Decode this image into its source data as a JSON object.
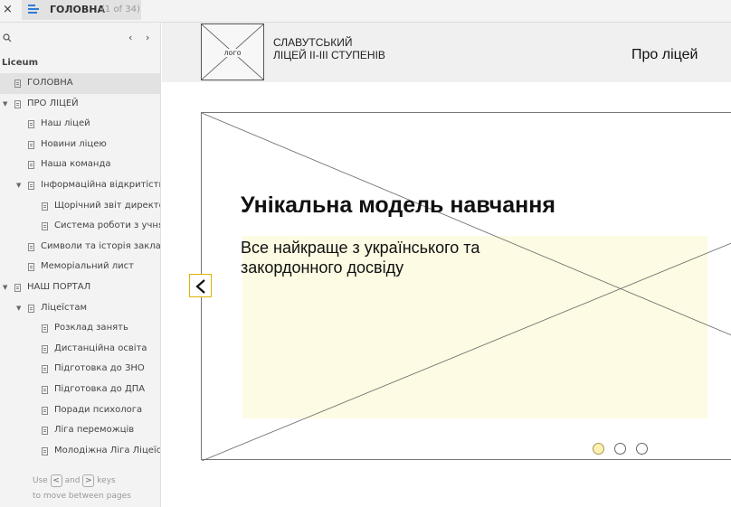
{
  "topbar": {
    "close_label": "×",
    "page_title": "ГОЛОВНА",
    "page_count": "(1 of 34)",
    "accent_color": "#2b7dd6"
  },
  "sidebar": {
    "search_icon": "search-icon",
    "prev_label": "‹",
    "next_label": "›",
    "project_name": "Liceum",
    "items": [
      {
        "label": "ГОЛОВНА",
        "level": 0,
        "expanded": null,
        "active": true
      },
      {
        "label": "ПРО ЛІЦЕЙ",
        "level": 0,
        "expanded": true,
        "active": false
      },
      {
        "label": "Наш ліцей",
        "level": 1,
        "expanded": null,
        "active": false
      },
      {
        "label": "Новини ліцею",
        "level": 1,
        "expanded": null,
        "active": false
      },
      {
        "label": "Наша команда",
        "level": 1,
        "expanded": null,
        "active": false
      },
      {
        "label": "Інформаційна відкритість",
        "level": 1,
        "expanded": true,
        "active": false
      },
      {
        "label": "Щорічний звіт директора",
        "level": 2,
        "expanded": null,
        "active": false
      },
      {
        "label": "Система роботи з учнями",
        "level": 2,
        "expanded": null,
        "active": false
      },
      {
        "label": "Символи та історія закладу",
        "level": 1,
        "expanded": null,
        "active": false
      },
      {
        "label": "Меморіальний лист",
        "level": 1,
        "expanded": null,
        "active": false
      },
      {
        "label": "НАШ ПОРТАЛ",
        "level": 0,
        "expanded": true,
        "active": false
      },
      {
        "label": "Ліцеїстам",
        "level": 1,
        "expanded": true,
        "active": false
      },
      {
        "label": "Розклад занять",
        "level": 2,
        "expanded": null,
        "active": false
      },
      {
        "label": "Дистанційна освіта",
        "level": 2,
        "expanded": null,
        "active": false
      },
      {
        "label": "Підготовка до ЗНО",
        "level": 2,
        "expanded": null,
        "active": false
      },
      {
        "label": "Підготовка до ДПА",
        "level": 2,
        "expanded": null,
        "active": false
      },
      {
        "label": "Поради психолога",
        "level": 2,
        "expanded": null,
        "active": false
      },
      {
        "label": "Ліга переможців",
        "level": 2,
        "expanded": null,
        "active": false
      },
      {
        "label": "Молодіжна Ліга Ліцеїстів",
        "level": 2,
        "expanded": null,
        "active": false
      }
    ],
    "hint": {
      "use": "Use",
      "key_prev": "<",
      "and": "and",
      "key_next": ">",
      "keys": "keys",
      "line2": "to move between pages"
    }
  },
  "page": {
    "header": {
      "logo_text": "лого",
      "school_line1": "СЛАВУТСЬКИЙ",
      "school_line2": "ЛІЦЕЙ ІІ-ІІІ СТУПЕНІВ",
      "nav_link": "Про ліцей"
    },
    "slider": {
      "title": "Унікальна модель навчання",
      "subtitle": "Все найкраще з українського та закордонного досвіду",
      "prev_icon": "chevron-left-icon",
      "dots": [
        {
          "active": true
        },
        {
          "active": false
        },
        {
          "active": false
        }
      ],
      "highlight_color": "#fdfbe3",
      "dot_active_color": "#fdf1b0"
    }
  }
}
